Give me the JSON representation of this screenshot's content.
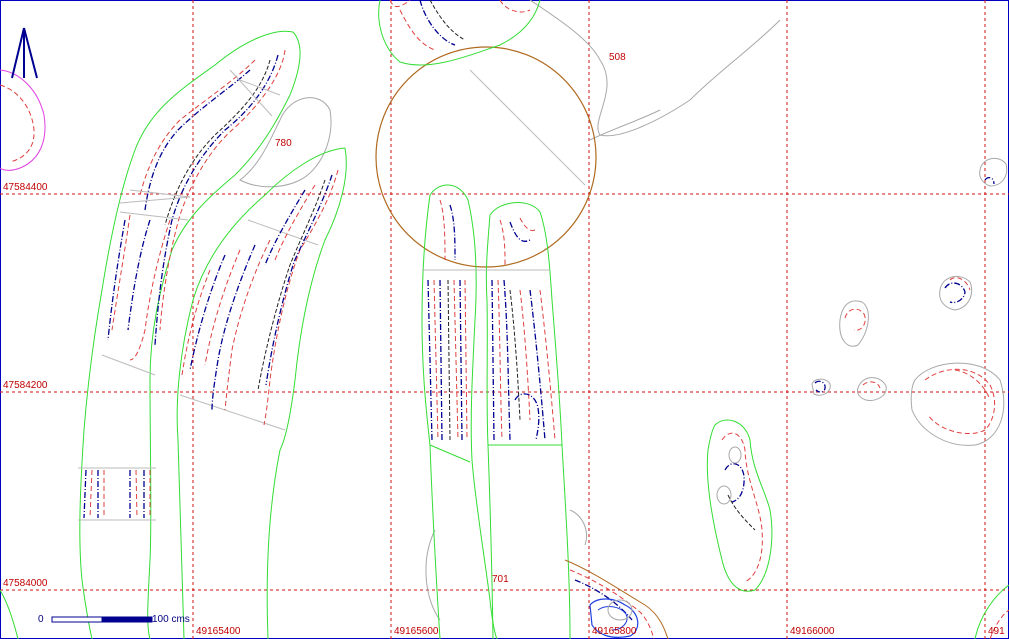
{
  "map": {
    "grid_labels_y": [
      "47584400",
      "47584200",
      "47584000"
    ],
    "grid_labels_x": [
      "49165400",
      "49165600",
      "49165800",
      "49166000",
      "491"
    ],
    "feature_labels": [
      "780",
      "508",
      "701"
    ],
    "scale": {
      "start": "0",
      "end_label": "100 cms"
    },
    "north_arrow": "north-arrow-icon",
    "colors": {
      "grid": "#d01010",
      "feature_outline": "#33dd33",
      "contour_red": "#e04040",
      "contour_blue": "#000090",
      "circle": "#b06a20",
      "pink": "#e040e0"
    }
  }
}
